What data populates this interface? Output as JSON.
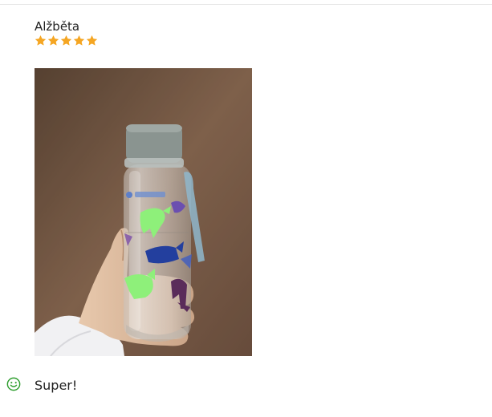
{
  "review": {
    "author": "Alžběta",
    "rating": 5,
    "rating_max": 5,
    "text": "Super!",
    "sentiment": "positive",
    "sentiment_icon": "smiley-icon"
  },
  "colors": {
    "star": "#f5a623",
    "sentiment": "#2e9e2e",
    "text": "#222222"
  }
}
